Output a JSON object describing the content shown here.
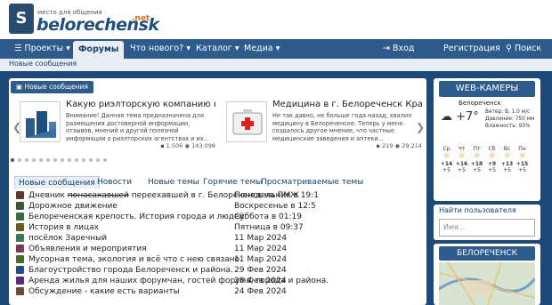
{
  "logo": {
    "mark": "S",
    "tagline": "место для общения",
    "name": "belorechensk",
    "suffix": ".net"
  },
  "nav": {
    "projects": "Проекты",
    "forums": "Форумы",
    "whats_new": "Что нового?",
    "catalog": "Каталог",
    "media": "Медиа",
    "login": "Вход",
    "register": "Регистрация",
    "search": "Поиск"
  },
  "breadcrumb": "Новые сообщения",
  "slider": {
    "tag": "Новые сообщения",
    "cards": [
      {
        "title": "Какую риэлторскую компанию выбра...",
        "text": "Внимание! Данная тема предназначена для размещения достоверной информации, отзывов, мнений и другой полезной информации о риэлторских агентствах и их...",
        "replies": "1.506",
        "views": "143.098"
      },
      {
        "title": "Медицина в г. Белореченск Краснода...",
        "text": "Не так давно, не больше года назад, хвалил медицину в Белореченске. Теперь у меня создалось другое мнение, что частные медицинские заведения и аптеки...",
        "replies": "219",
        "views": "29.214"
      }
    ]
  },
  "tabs": [
    "Новые сообщения",
    "Новости",
    "Новые темы",
    "Горячие темы",
    "Просматриваемые темы"
  ],
  "threads": [
    {
      "pre": "Дневник ",
      "strike": "понасахавшей",
      "rest": " переехавшей в г. Белореченск на ПМЖ",
      "date": "Понедельник в 19:1",
      "color": "#5a3a2a"
    },
    {
      "pre": "Дорожное движение",
      "strike": "",
      "rest": "",
      "date": "Воскресенье в 12:5",
      "color": "#3a5a3a"
    },
    {
      "pre": "Белореченская крепость. История города и людей.",
      "strike": "",
      "rest": "",
      "date": "Суббота в 01:19",
      "color": "#3a6a3a"
    },
    {
      "pre": "История в лицах",
      "strike": "",
      "rest": "",
      "date": "Пятница в 09:37",
      "color": "#6a5a2a"
    },
    {
      "pre": "посёлок Заречный",
      "strike": "",
      "rest": "",
      "date": "11 Мар 2024",
      "color": "#3a7a5a"
    },
    {
      "pre": "Объявления и мероприятия",
      "strike": "",
      "rest": "",
      "date": "11 Мар 2024",
      "color": "#7a3a5a"
    },
    {
      "pre": "Мусорная тема, экология и всё что с нею связано.",
      "strike": "",
      "rest": "",
      "date": "11 Мар 2024",
      "color": "#4a6a2a"
    },
    {
      "pre": "Благоустройство города Белореченск и района.",
      "strike": "",
      "rest": "",
      "date": "29 Фев 2024",
      "color": "#2a4a7a"
    },
    {
      "pre": "Аренда жилья для наших форумчан, гостей форума, города и района.",
      "strike": "",
      "rest": "",
      "date": "28 Фев 2024",
      "color": "#5a2a7a"
    },
    {
      "pre": "Обсуждение - какие есть варианты",
      "strike": "",
      "rest": "",
      "date": "24 Фев 2024",
      "color": "#6a4a3a"
    }
  ],
  "sidebar": {
    "cam_title": "WEB-КАМЕРЫ",
    "weather": {
      "city": "Белореченск",
      "temp": "+7°",
      "wind": "Ветер: В, 1.0 м/с",
      "pressure": "Давление: 750 мм",
      "humidity": "Влажность: 93%",
      "days": [
        "Ср",
        "Чт",
        "Пт",
        "Сб",
        "Вс",
        "Пн",
        "Вт"
      ],
      "day_temps": [
        "+14",
        "+16",
        "+18",
        "+9",
        "+13",
        "+15",
        "+14"
      ],
      "night_temps": [
        "+5",
        "+5",
        "+5",
        "+5",
        "+5",
        "+5",
        "+5"
      ]
    },
    "find_user": "Найти пользователя",
    "name_placeholder": "Имя...",
    "map_title": "БЕЛОРЕЧЕНСК"
  }
}
